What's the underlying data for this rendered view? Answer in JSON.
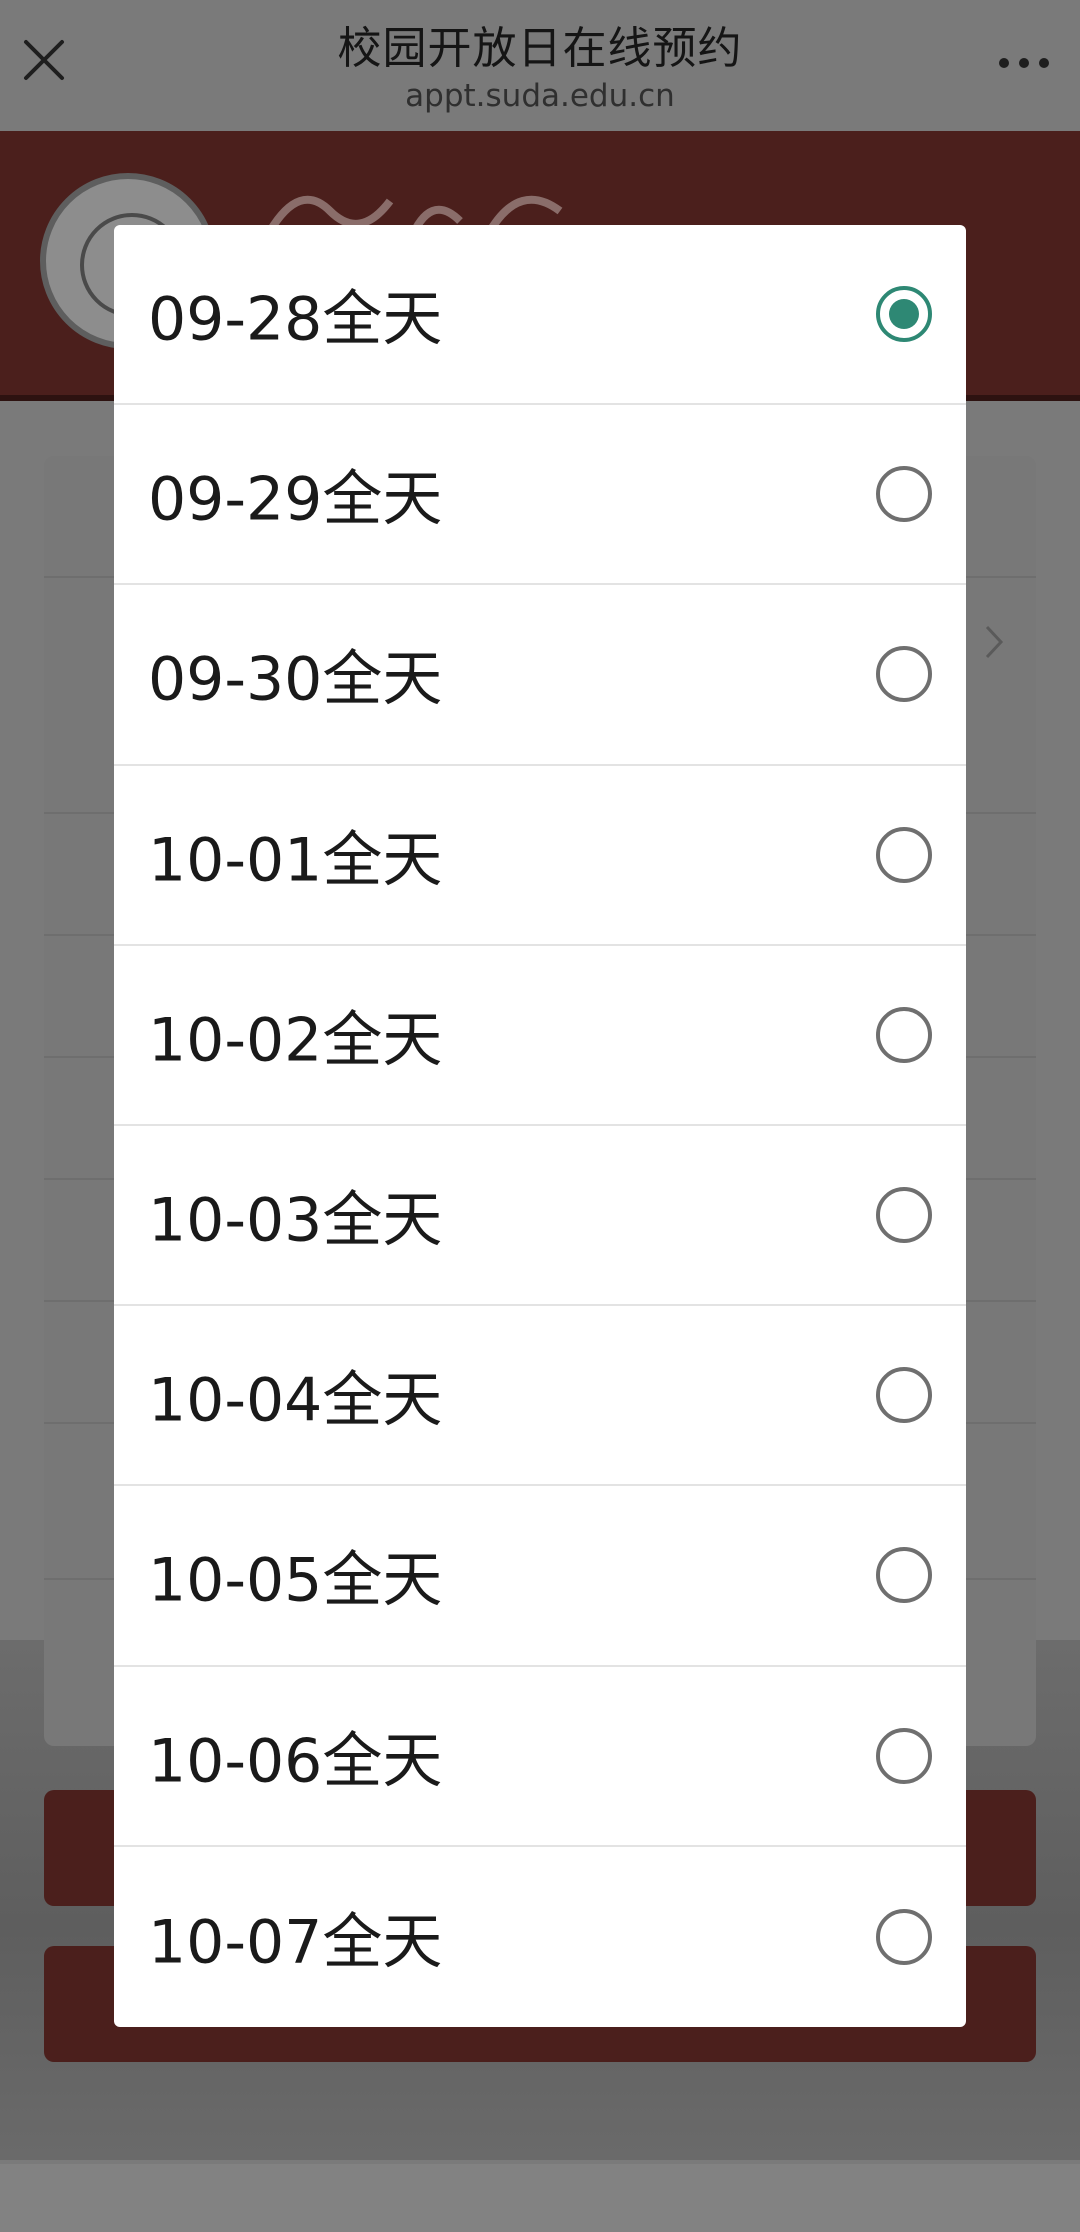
{
  "browser": {
    "title": "校园开放日在线预约",
    "url": "appt.suda.edu.cn",
    "close_icon": "close-icon",
    "more_icon": "more-horizontal-icon"
  },
  "dialog": {
    "options": [
      {
        "label": "09-28全天",
        "checked": true
      },
      {
        "label": "09-29全天",
        "checked": false
      },
      {
        "label": "09-30全天",
        "checked": false
      },
      {
        "label": "10-01全天",
        "checked": false
      },
      {
        "label": "10-02全天",
        "checked": false
      },
      {
        "label": "10-03全天",
        "checked": false
      },
      {
        "label": "10-04全天",
        "checked": false
      },
      {
        "label": "10-05全天",
        "checked": false
      },
      {
        "label": "10-06全天",
        "checked": false
      },
      {
        "label": "10-07全天",
        "checked": false
      }
    ]
  },
  "colors": {
    "overlay": "#7a7a7a",
    "radio_checked": "#2e8874",
    "radio_unchecked": "#6f6f6f",
    "banner": "#4b1f1c"
  }
}
